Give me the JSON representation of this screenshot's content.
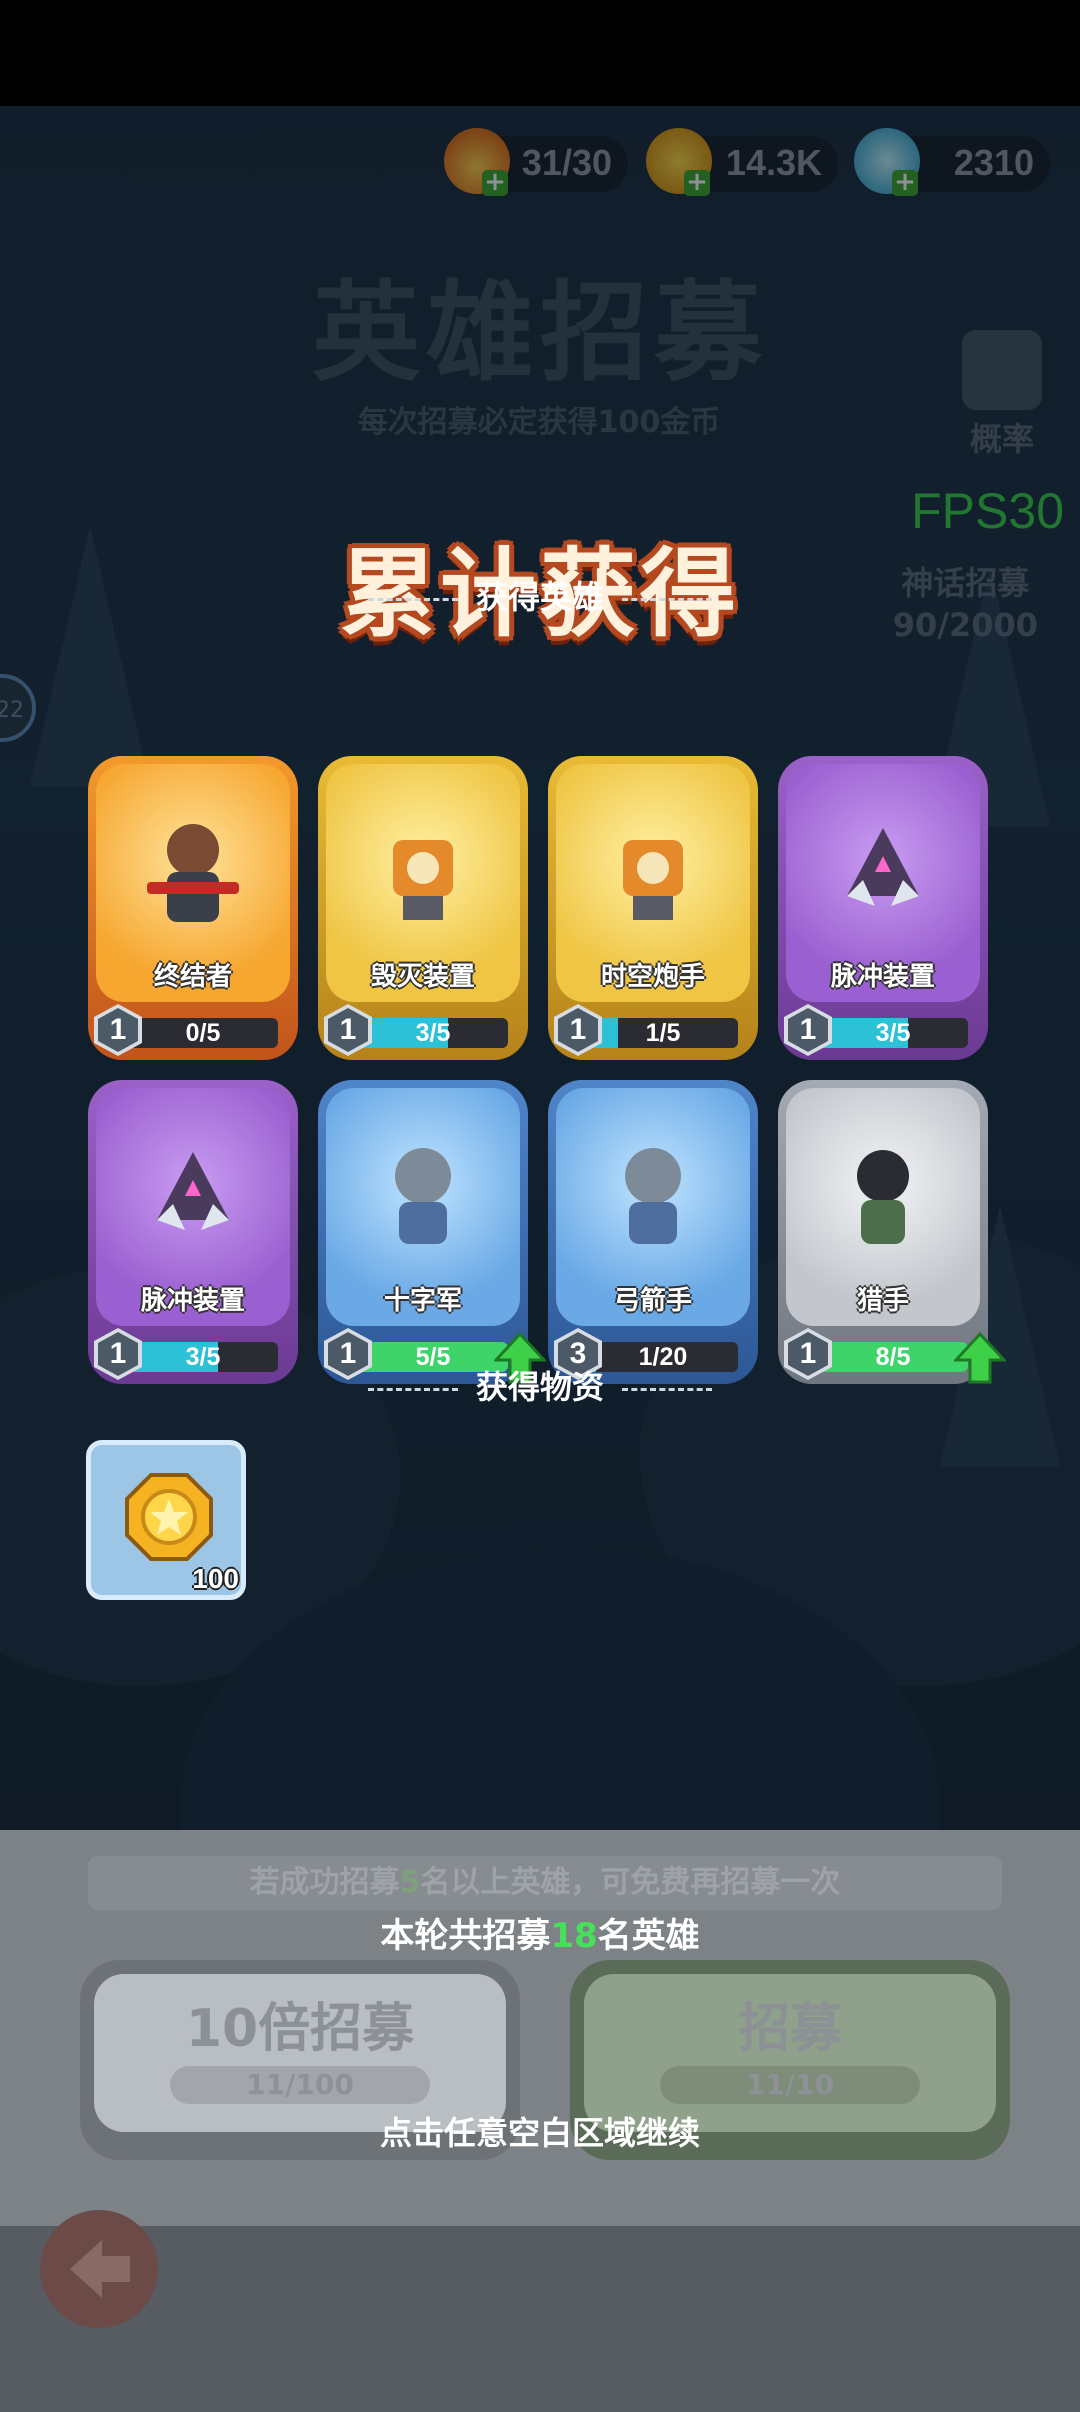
{
  "resources": [
    {
      "icon": "energy-flame-icon",
      "value": "31/30"
    },
    {
      "icon": "gold-coin-icon",
      "value": "14.3K"
    },
    {
      "icon": "gem-crystal-icon",
      "value": "2310"
    }
  ],
  "background": {
    "title": "英雄招募",
    "subtitle": "每次招募必定获得100金币",
    "rate_label": "概率",
    "fps": "FPS30",
    "myth_label": "神话招募",
    "myth_progress": "90/2000",
    "left_badge": "22"
  },
  "overlay": {
    "title": "累计获得",
    "heroes_header": "获得英雄",
    "items_header": "获得物资",
    "summary_prefix": "本轮共招募",
    "summary_count": "18",
    "summary_suffix": "名英雄",
    "continue_hint": "点击任意空白区域继续"
  },
  "heroes": [
    {
      "name": "终结者",
      "level": "1",
      "progress": "0/5",
      "fraction": 0.0,
      "rarity": "orange",
      "upgradable": false
    },
    {
      "name": "毁灭装置",
      "level": "1",
      "progress": "3/5",
      "fraction": 0.6,
      "rarity": "yellow",
      "upgradable": false
    },
    {
      "name": "时空炮手",
      "level": "1",
      "progress": "1/5",
      "fraction": 0.2,
      "rarity": "yellow",
      "upgradable": false
    },
    {
      "name": "脉冲装置",
      "level": "1",
      "progress": "3/5",
      "fraction": 0.6,
      "rarity": "purple",
      "upgradable": false
    },
    {
      "name": "脉冲装置",
      "level": "1",
      "progress": "3/5",
      "fraction": 0.6,
      "rarity": "purple",
      "upgradable": false
    },
    {
      "name": "十字军",
      "level": "1",
      "progress": "5/5",
      "fraction": 1.0,
      "rarity": "blue",
      "upgradable": true
    },
    {
      "name": "弓箭手",
      "level": "3",
      "progress": "1/20",
      "fraction": 0.05,
      "rarity": "blue",
      "upgradable": false
    },
    {
      "name": "猎手",
      "level": "1",
      "progress": "8/5",
      "fraction": 1.0,
      "rarity": "gray",
      "upgradable": true
    }
  ],
  "items": [
    {
      "icon": "gold-coin-icon",
      "count": "100"
    }
  ],
  "bottom_panel": {
    "hint_prefix": "若成功招募",
    "hint_count": "5",
    "hint_suffix": "名以上英雄，可免费再招募一次",
    "ten_recruit_label": "10倍招募",
    "ten_recruit_cost": "11/100",
    "recruit_label": "招募",
    "recruit_cost": "11/10"
  },
  "colors": {
    "highlight_green": "#46e05a",
    "progress_cyan": "#2cc1d6",
    "progress_green": "#3fd46a",
    "title_outline": "#b5481f"
  }
}
